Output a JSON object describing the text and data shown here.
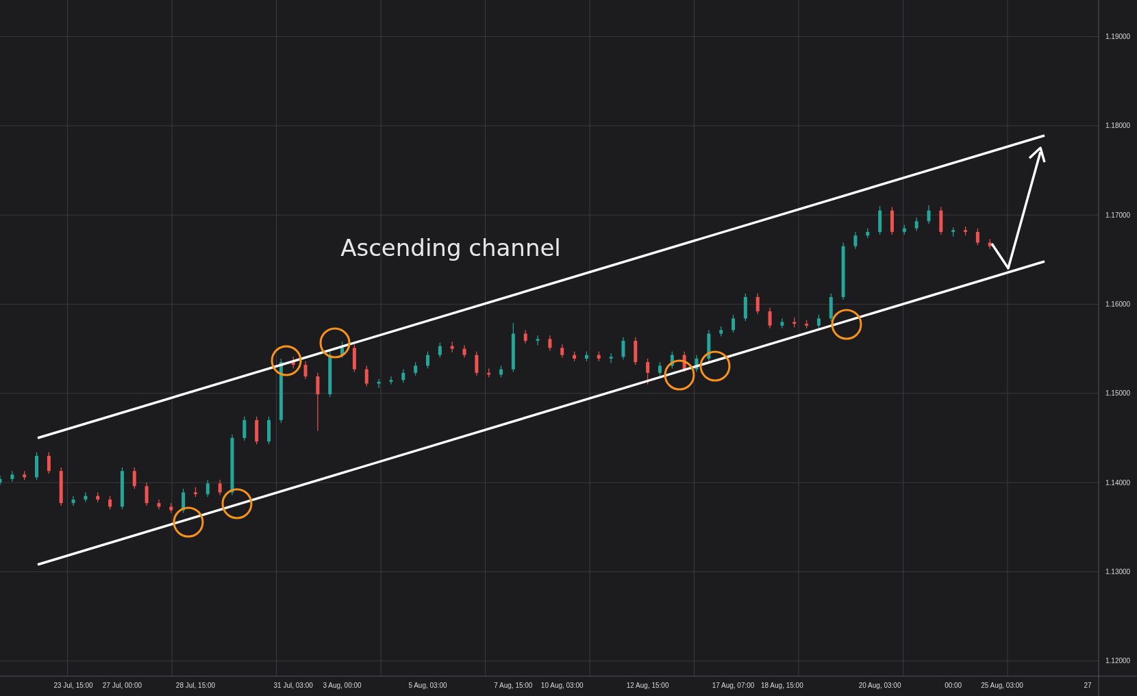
{
  "chart_data": {
    "type": "candlestick",
    "grid": true,
    "categories": [
      null,
      null,
      null,
      null,
      null,
      null,
      "23 Jul, 15:00",
      null,
      null,
      null,
      "27 Jul, 00:00",
      null,
      null,
      null,
      null,
      null,
      "28 Jul, 15:00",
      null,
      null,
      null,
      null,
      null,
      null,
      null,
      "31 Jul, 03:00",
      null,
      null,
      null,
      "3 Aug, 00:00",
      null,
      null,
      null,
      null,
      null,
      null,
      "5 Aug, 03:00",
      null,
      null,
      null,
      null,
      null,
      null,
      "7 Aug, 15:00",
      null,
      null,
      null,
      "10 Aug, 03:00",
      null,
      null,
      null,
      null,
      null,
      null,
      "12 Aug, 15:00",
      null,
      null,
      null,
      null,
      null,
      null,
      "17 Aug, 07:00",
      null,
      null,
      null,
      "18 Aug, 15:00",
      null,
      null,
      null,
      null,
      null,
      null,
      null,
      "20 Aug, 03:00",
      null,
      null,
      null,
      null,
      null,
      "00:00",
      null,
      null,
      null,
      "25 Aug, 03:00",
      null,
      null,
      null,
      null,
      null,
      null,
      "27"
    ],
    "ohlc": [
      [
        1.14,
        1.1408,
        1.1397,
        1.1404
      ],
      [
        1.1404,
        1.1413,
        1.1401,
        1.1409
      ],
      [
        1.1409,
        1.1413,
        1.1403,
        1.1406
      ],
      [
        1.1406,
        1.1434,
        1.1403,
        1.143
      ],
      [
        1.143,
        1.1434,
        1.141,
        1.1413
      ],
      [
        1.1413,
        1.1417,
        1.1374,
        1.1377
      ],
      [
        1.1377,
        1.1385,
        1.1374,
        1.1381
      ],
      [
        1.1381,
        1.1389,
        1.1378,
        1.1385
      ],
      [
        1.1385,
        1.1389,
        1.1378,
        1.1381
      ],
      [
        1.1381,
        1.1385,
        1.137,
        1.1373
      ],
      [
        1.1373,
        1.1417,
        1.137,
        1.1413
      ],
      [
        1.1413,
        1.1417,
        1.1393,
        1.1396
      ],
      [
        1.1396,
        1.14,
        1.1374,
        1.1377
      ],
      [
        1.1377,
        1.1381,
        1.137,
        1.1373
      ],
      [
        1.1373,
        1.1377,
        1.1366,
        1.1369
      ],
      [
        1.1369,
        1.1393,
        1.1366,
        1.1389
      ],
      [
        1.1389,
        1.1395,
        1.1384,
        1.1387
      ],
      [
        1.1387,
        1.1403,
        1.1384,
        1.1399
      ],
      [
        1.1399,
        1.1403,
        1.1386,
        1.1389
      ],
      [
        1.1389,
        1.1454,
        1.1386,
        1.145
      ],
      [
        1.145,
        1.1474,
        1.1447,
        1.147
      ],
      [
        1.147,
        1.1474,
        1.1443,
        1.1446
      ],
      [
        1.1446,
        1.1474,
        1.1443,
        1.147
      ],
      [
        1.147,
        1.1539,
        1.1467,
        1.1535
      ],
      [
        1.1535,
        1.1541,
        1.1528,
        1.1532
      ],
      [
        1.1532,
        1.1536,
        1.1516,
        1.1519
      ],
      [
        1.1519,
        1.1523,
        1.1458,
        1.1499
      ],
      [
        1.1499,
        1.1547,
        1.1496,
        1.1543
      ],
      [
        1.1543,
        1.1558,
        1.154,
        1.1551
      ],
      [
        1.1551,
        1.1555,
        1.1524,
        1.1527
      ],
      [
        1.1527,
        1.1531,
        1.1508,
        1.1511
      ],
      [
        1.1511,
        1.1516,
        1.1506,
        1.1513
      ],
      [
        1.1513,
        1.1519,
        1.151,
        1.1515
      ],
      [
        1.1515,
        1.1527,
        1.1512,
        1.1523
      ],
      [
        1.1523,
        1.1535,
        1.152,
        1.1531
      ],
      [
        1.1531,
        1.1547,
        1.1528,
        1.1543
      ],
      [
        1.1543,
        1.1557,
        1.154,
        1.1553
      ],
      [
        1.1553,
        1.1558,
        1.1546,
        1.155
      ],
      [
        1.155,
        1.1554,
        1.154,
        1.1543
      ],
      [
        1.1543,
        1.1547,
        1.152,
        1.1523
      ],
      [
        1.1523,
        1.1528,
        1.1518,
        1.1521
      ],
      [
        1.1521,
        1.1531,
        1.1518,
        1.1527
      ],
      [
        1.1527,
        1.1579,
        1.1524,
        1.1567
      ],
      [
        1.1567,
        1.1571,
        1.1556,
        1.1559
      ],
      [
        1.1559,
        1.1565,
        1.1554,
        1.1561
      ],
      [
        1.1561,
        1.1565,
        1.1548,
        1.1551
      ],
      [
        1.1551,
        1.1555,
        1.154,
        1.1543
      ],
      [
        1.1543,
        1.1547,
        1.1536,
        1.1539
      ],
      [
        1.1539,
        1.1547,
        1.1536,
        1.1543
      ],
      [
        1.1543,
        1.1547,
        1.1536,
        1.1539
      ],
      [
        1.1539,
        1.1545,
        1.1534,
        1.1541
      ],
      [
        1.1541,
        1.1563,
        1.1538,
        1.1559
      ],
      [
        1.1559,
        1.1563,
        1.1532,
        1.1535
      ],
      [
        1.1535,
        1.1539,
        1.151,
        1.1523
      ],
      [
        1.1523,
        1.1535,
        1.152,
        1.1531
      ],
      [
        1.1531,
        1.1547,
        1.1528,
        1.1543
      ],
      [
        1.1543,
        1.1547,
        1.1524,
        1.1527
      ],
      [
        1.1527,
        1.1543,
        1.1524,
        1.1539
      ],
      [
        1.1539,
        1.1571,
        1.1536,
        1.1567
      ],
      [
        1.1567,
        1.1575,
        1.1564,
        1.1571
      ],
      [
        1.1571,
        1.1588,
        1.1568,
        1.1584
      ],
      [
        1.1584,
        1.1612,
        1.1581,
        1.1608
      ],
      [
        1.1608,
        1.1612,
        1.1589,
        1.1592
      ],
      [
        1.1592,
        1.1596,
        1.1573,
        1.1576
      ],
      [
        1.1576,
        1.1584,
        1.1573,
        1.158
      ],
      [
        1.158,
        1.1585,
        1.1574,
        1.1578
      ],
      [
        1.1578,
        1.1582,
        1.1573,
        1.1576
      ],
      [
        1.1576,
        1.1588,
        1.1573,
        1.1584
      ],
      [
        1.1584,
        1.1612,
        1.1581,
        1.1608
      ],
      [
        1.1608,
        1.1669,
        1.1605,
        1.1665
      ],
      [
        1.1665,
        1.1681,
        1.1662,
        1.1677
      ],
      [
        1.1677,
        1.1685,
        1.1674,
        1.1681
      ],
      [
        1.1681,
        1.171,
        1.1678,
        1.1705
      ],
      [
        1.1705,
        1.1709,
        1.1678,
        1.1681
      ],
      [
        1.1681,
        1.1689,
        1.1678,
        1.1685
      ],
      [
        1.1685,
        1.1697,
        1.1682,
        1.1693
      ],
      [
        1.1693,
        1.1711,
        1.169,
        1.1705
      ],
      [
        1.1705,
        1.1709,
        1.1678,
        1.1681
      ],
      [
        1.1681,
        1.1686,
        1.1676,
        1.1683
      ],
      [
        1.1683,
        1.1687,
        1.1677,
        1.1681
      ],
      [
        1.1681,
        1.1685,
        1.1666,
        1.1669
      ],
      [
        1.1669,
        1.1673,
        1.1662,
        1.1665
      ],
      null,
      null,
      null,
      null,
      null,
      null,
      null,
      null
    ],
    "ylim": [
      1.1183,
      1.1941
    ],
    "yticks": [
      {
        "value": 1.19,
        "label": "1.19000"
      },
      {
        "value": 1.18,
        "label": "1.18000"
      },
      {
        "value": 1.17,
        "label": "1.17000"
      },
      {
        "value": 1.16,
        "label": "1.16000"
      },
      {
        "value": 1.15,
        "label": "1.15000"
      },
      {
        "value": 1.14,
        "label": "1.14000"
      },
      {
        "value": 1.13,
        "label": "1.13000"
      },
      {
        "value": 1.12,
        "label": "1.12000"
      }
    ],
    "annotations": [
      {
        "text": "Ascending channel"
      }
    ]
  }
}
